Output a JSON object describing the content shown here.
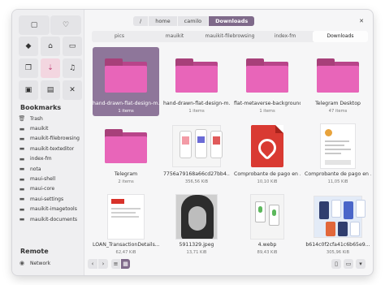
{
  "sidebar": {
    "top_buttons": [
      {
        "icon": "panel-icon",
        "glyph": "▢"
      },
      {
        "icon": "heart-icon",
        "glyph": "♡"
      }
    ],
    "places": [
      {
        "icon": "tag-icon",
        "glyph": "◆",
        "active": false
      },
      {
        "icon": "home-icon",
        "glyph": "⌂",
        "active": false
      },
      {
        "icon": "desktop-icon",
        "glyph": "▭",
        "active": false
      },
      {
        "icon": "documents-icon",
        "glyph": "❐",
        "active": false
      },
      {
        "icon": "downloads-icon",
        "glyph": "⇣",
        "active": true
      },
      {
        "icon": "music-icon",
        "glyph": "♫",
        "active": false
      },
      {
        "icon": "pictures-icon",
        "glyph": "▣",
        "active": false
      },
      {
        "icon": "videos-icon",
        "glyph": "▤",
        "active": false
      },
      {
        "icon": "trash-icon",
        "glyph": "✕",
        "active": false
      }
    ],
    "bookmarks_heading": "Bookmarks",
    "bookmarks": [
      {
        "label": "Trash",
        "icon": "trash-icon",
        "glyph": "🗑"
      },
      {
        "label": "mauikit",
        "icon": "folder-icon",
        "glyph": "▬"
      },
      {
        "label": "mauikit-filebrowsing",
        "icon": "folder-icon",
        "glyph": "▬"
      },
      {
        "label": "mauikit-texteditor",
        "icon": "folder-icon",
        "glyph": "▬"
      },
      {
        "label": "index-fm",
        "icon": "folder-icon",
        "glyph": "▬"
      },
      {
        "label": "nota",
        "icon": "folder-icon",
        "glyph": "▬"
      },
      {
        "label": "maui-shell",
        "icon": "folder-icon",
        "glyph": "▬"
      },
      {
        "label": "maui-core",
        "icon": "folder-icon",
        "glyph": "▬"
      },
      {
        "label": "maui-settings",
        "icon": "folder-icon",
        "glyph": "▬"
      },
      {
        "label": "mauikit-imagetools",
        "icon": "folder-icon",
        "glyph": "▬"
      },
      {
        "label": "mauikit-documents",
        "icon": "folder-icon",
        "glyph": "▬"
      }
    ],
    "remote_heading": "Remote",
    "remote": [
      {
        "label": "Network",
        "icon": "network-icon",
        "glyph": "◉"
      }
    ]
  },
  "header": {
    "breadcrumbs": [
      "/",
      "home",
      "camilo",
      "Downloads"
    ],
    "close_glyph": "✕"
  },
  "tabs": [
    {
      "label": "pics",
      "active": false
    },
    {
      "label": "mauikit",
      "active": false
    },
    {
      "label": "mauikit-filebrowsing",
      "active": false
    },
    {
      "label": "index-fm",
      "active": false
    },
    {
      "label": "Downloads",
      "active": true
    }
  ],
  "files": [
    {
      "name": "hand-drawn-flat-design-m...",
      "meta": "1 items",
      "kind": "folder",
      "selected": true
    },
    {
      "name": "hand-drawn-flat-design-m...",
      "meta": "1 items",
      "kind": "folder",
      "selected": false
    },
    {
      "name": "flat-metaverse-background",
      "meta": "1 items",
      "kind": "folder",
      "selected": false
    },
    {
      "name": "Telegram Desktop",
      "meta": "47 items",
      "kind": "folder",
      "selected": false
    },
    {
      "name": "Telegram",
      "meta": "2 items",
      "kind": "folder",
      "selected": false
    },
    {
      "name": "7756a79168a66cd27bb4...",
      "meta": "356,56 KiB",
      "kind": "phone-image",
      "selected": false
    },
    {
      "name": "Comprobante de pago en ...",
      "meta": "10,10 KiB",
      "kind": "pdf",
      "selected": false
    },
    {
      "name": "Comprobante de pago en ...",
      "meta": "11,05 KiB",
      "kind": "doc",
      "selected": false
    },
    {
      "name": "LOAN_TransactionDetails...",
      "meta": "62,47 KiB",
      "kind": "doc-red",
      "selected": false
    },
    {
      "name": "5911329.jpeg",
      "meta": "13,71 KiB",
      "kind": "photo",
      "selected": false
    },
    {
      "name": "4.webp",
      "meta": "89,43 KiB",
      "kind": "mockup",
      "selected": false
    },
    {
      "name": "b614c0f2cfa41c6b65e9...",
      "meta": "305,96 KiB",
      "kind": "app-image",
      "selected": false
    }
  ],
  "bottombar": {
    "back_glyph": "‹",
    "forward_glyph": "›",
    "grid_view_glyph": "▦",
    "list_view_glyph": "≡",
    "menu_glyph": "▾",
    "split_glyph": "▯",
    "terminal_glyph": "▭"
  },
  "colors": {
    "accent": "#7f6a8a",
    "folder_pink": "#e865b9",
    "folder_dark": "#b8458a",
    "selection": "#8e769a"
  }
}
